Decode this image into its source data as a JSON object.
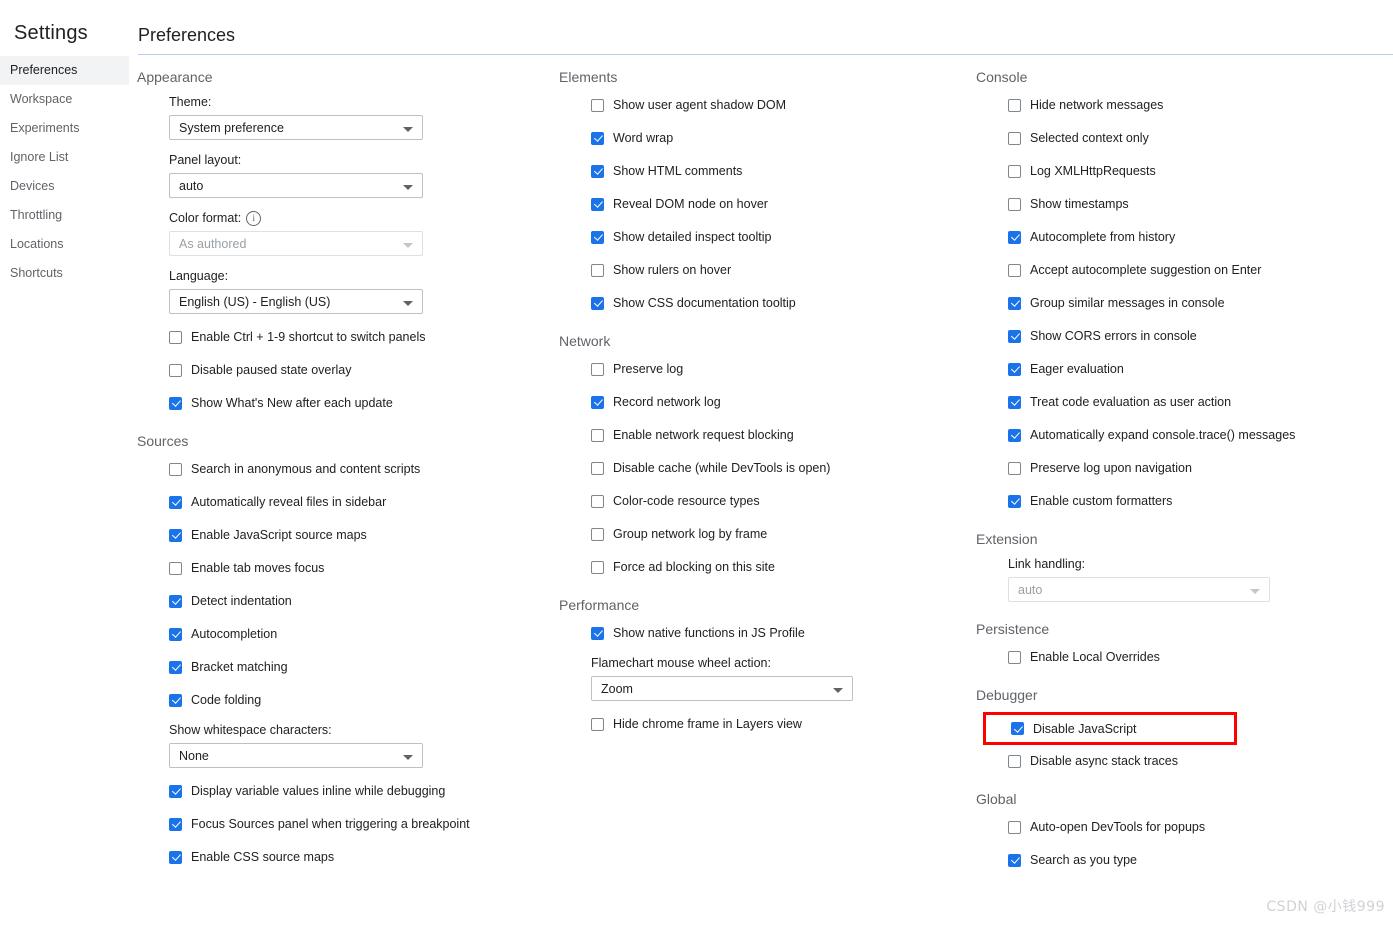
{
  "sidebar": {
    "title": "Settings",
    "items": [
      {
        "label": "Preferences",
        "selected": true
      },
      {
        "label": "Workspace",
        "selected": false
      },
      {
        "label": "Experiments",
        "selected": false
      },
      {
        "label": "Ignore List",
        "selected": false
      },
      {
        "label": "Devices",
        "selected": false
      },
      {
        "label": "Throttling",
        "selected": false
      },
      {
        "label": "Locations",
        "selected": false
      },
      {
        "label": "Shortcuts",
        "selected": false
      }
    ]
  },
  "pane": {
    "title": "Preferences"
  },
  "colors": {
    "accent": "#1a73e8",
    "highlight": "#ff0000",
    "divider": "#b3cef7",
    "selected_tab_bg": "#f1f3f4",
    "section_title": "#5f6368"
  },
  "sections": {
    "appearance": {
      "title": "Appearance",
      "theme_label": "Theme:",
      "theme_value": "System preference",
      "panel_layout_label": "Panel layout:",
      "panel_layout_value": "auto",
      "color_format_label": "Color format:",
      "color_format_value": "As authored",
      "color_format_info": "i",
      "language_label": "Language:",
      "language_value": "English (US) - English (US)",
      "checkboxes": [
        {
          "label": "Enable Ctrl + 1-9 shortcut to switch panels",
          "checked": false
        },
        {
          "label": "Disable paused state overlay",
          "checked": false
        },
        {
          "label": "Show What's New after each update",
          "checked": true
        }
      ]
    },
    "sources": {
      "title": "Sources",
      "checkboxes_top": [
        {
          "label": "Search in anonymous and content scripts",
          "checked": false
        },
        {
          "label": "Automatically reveal files in sidebar",
          "checked": true
        },
        {
          "label": "Enable JavaScript source maps",
          "checked": true
        },
        {
          "label": "Enable tab moves focus",
          "checked": false
        },
        {
          "label": "Detect indentation",
          "checked": true
        },
        {
          "label": "Autocompletion",
          "checked": true
        },
        {
          "label": "Bracket matching",
          "checked": true
        },
        {
          "label": "Code folding",
          "checked": true
        }
      ],
      "whitespace_label": "Show whitespace characters:",
      "whitespace_value": "None",
      "checkboxes_bottom": [
        {
          "label": "Display variable values inline while debugging",
          "checked": true
        },
        {
          "label": "Focus Sources panel when triggering a breakpoint",
          "checked": true
        },
        {
          "label": "Enable CSS source maps",
          "checked": true
        }
      ]
    },
    "elements": {
      "title": "Elements",
      "checkboxes": [
        {
          "label": "Show user agent shadow DOM",
          "checked": false
        },
        {
          "label": "Word wrap",
          "checked": true
        },
        {
          "label": "Show HTML comments",
          "checked": true
        },
        {
          "label": "Reveal DOM node on hover",
          "checked": true
        },
        {
          "label": "Show detailed inspect tooltip",
          "checked": true
        },
        {
          "label": "Show rulers on hover",
          "checked": false
        },
        {
          "label": "Show CSS documentation tooltip",
          "checked": true
        }
      ]
    },
    "network": {
      "title": "Network",
      "checkboxes": [
        {
          "label": "Preserve log",
          "checked": false
        },
        {
          "label": "Record network log",
          "checked": true
        },
        {
          "label": "Enable network request blocking",
          "checked": false
        },
        {
          "label": "Disable cache (while DevTools is open)",
          "checked": false
        },
        {
          "label": "Color-code resource types",
          "checked": false
        },
        {
          "label": "Group network log by frame",
          "checked": false
        },
        {
          "label": "Force ad blocking on this site",
          "checked": false
        }
      ]
    },
    "performance": {
      "title": "Performance",
      "checkbox_native": {
        "label": "Show native functions in JS Profile",
        "checked": true
      },
      "flamechart_label": "Flamechart mouse wheel action:",
      "flamechart_value": "Zoom",
      "checkbox_hide_chrome": {
        "label": "Hide chrome frame in Layers view",
        "checked": false
      }
    },
    "console": {
      "title": "Console",
      "checkboxes": [
        {
          "label": "Hide network messages",
          "checked": false
        },
        {
          "label": "Selected context only",
          "checked": false
        },
        {
          "label": "Log XMLHttpRequests",
          "checked": false
        },
        {
          "label": "Show timestamps",
          "checked": false
        },
        {
          "label": "Autocomplete from history",
          "checked": true
        },
        {
          "label": "Accept autocomplete suggestion on Enter",
          "checked": false
        },
        {
          "label": "Group similar messages in console",
          "checked": true
        },
        {
          "label": "Show CORS errors in console",
          "checked": true
        },
        {
          "label": "Eager evaluation",
          "checked": true
        },
        {
          "label": "Treat code evaluation as user action",
          "checked": true
        },
        {
          "label": "Automatically expand console.trace() messages",
          "checked": true
        },
        {
          "label": "Preserve log upon navigation",
          "checked": false
        },
        {
          "label": "Enable custom formatters",
          "checked": true
        }
      ]
    },
    "extension": {
      "title": "Extension",
      "link_handling_label": "Link handling:",
      "link_handling_value": "auto"
    },
    "persistence": {
      "title": "Persistence",
      "checkboxes": [
        {
          "label": "Enable Local Overrides",
          "checked": false
        }
      ]
    },
    "debugger": {
      "title": "Debugger",
      "checkbox_disable_js": {
        "label": "Disable JavaScript",
        "checked": true,
        "highlighted": true
      },
      "checkbox_async": {
        "label": "Disable async stack traces",
        "checked": false
      }
    },
    "global": {
      "title": "Global",
      "checkboxes": [
        {
          "label": "Auto-open DevTools for popups",
          "checked": false
        },
        {
          "label": "Search as you type",
          "checked": true
        }
      ]
    }
  },
  "watermark": "CSDN @小钱999"
}
